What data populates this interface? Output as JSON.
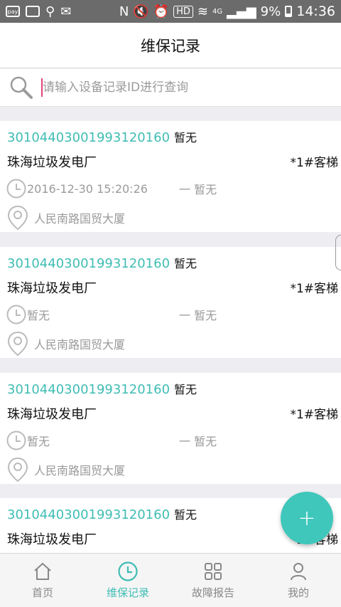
{
  "status_bar": {
    "left_icons": [
      "pay-icon",
      "image-icon",
      "usb-icon",
      "mail-icon"
    ],
    "hd": "HD",
    "network": "4G",
    "battery": "9%",
    "time": "14:36"
  },
  "header": {
    "title": "维保记录"
  },
  "search": {
    "placeholder": "请输入设备记录ID进行查询"
  },
  "records": [
    {
      "code": "30104403001993120160",
      "code_status": "暂无",
      "name": "珠海垃圾发电厂",
      "type": "*1#客梯",
      "start": "2016-12-30 15:20:26",
      "end": "一 暂无",
      "location": "人民南路国贸大厦"
    },
    {
      "code": "30104403001993120160",
      "code_status": "暂无",
      "name": "珠海垃圾发电厂",
      "type": "*1#客梯",
      "start": "暂无",
      "end": "一 暂无",
      "location": "人民南路国贸大厦"
    },
    {
      "code": "30104403001993120160",
      "code_status": "暂无",
      "name": "珠海垃圾发电厂",
      "type": "*1#客梯",
      "start": "暂无",
      "end": "一 暂无",
      "location": "人民南路国贸大厦"
    },
    {
      "code": "30104403001993120160",
      "code_status": "暂无",
      "name": "珠海垃圾发电厂",
      "type": "*1#客梯",
      "start": "",
      "end": "",
      "location": ""
    }
  ],
  "fab": {
    "label": "+"
  },
  "tabs": [
    {
      "label": "首页",
      "icon": "home-icon"
    },
    {
      "label": "维保记录",
      "icon": "clock-icon"
    },
    {
      "label": "故障报告",
      "icon": "grid-icon"
    },
    {
      "label": "我的",
      "icon": "person-icon"
    }
  ],
  "colors": {
    "accent": "#3fbdb4",
    "status_bar": "#6b6b6b",
    "background": "#eeeef2"
  }
}
